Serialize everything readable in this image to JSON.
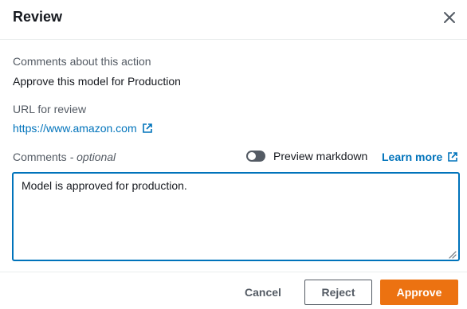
{
  "dialog": {
    "title": "Review"
  },
  "comments_about_action": {
    "label": "Comments about this action",
    "value": "Approve this model for Production"
  },
  "url_for_review": {
    "label": "URL for review",
    "link_text": "https://www.amazon.com"
  },
  "comments": {
    "label": "Comments",
    "optional_text": " - optional",
    "value": "Model is approved for production.",
    "preview_markdown_label": "Preview markdown",
    "preview_markdown_enabled": false,
    "learn_more_label": "Learn more"
  },
  "footer": {
    "cancel_label": "Cancel",
    "reject_label": "Reject",
    "approve_label": "Approve"
  },
  "colors": {
    "link": "#0073bb",
    "primary_button": "#ec7211",
    "text": "#16191f",
    "secondary_text": "#545b64"
  },
  "icons": {
    "close": "close-icon",
    "external_link": "external-link-icon",
    "resize": "resize-handle-icon"
  }
}
